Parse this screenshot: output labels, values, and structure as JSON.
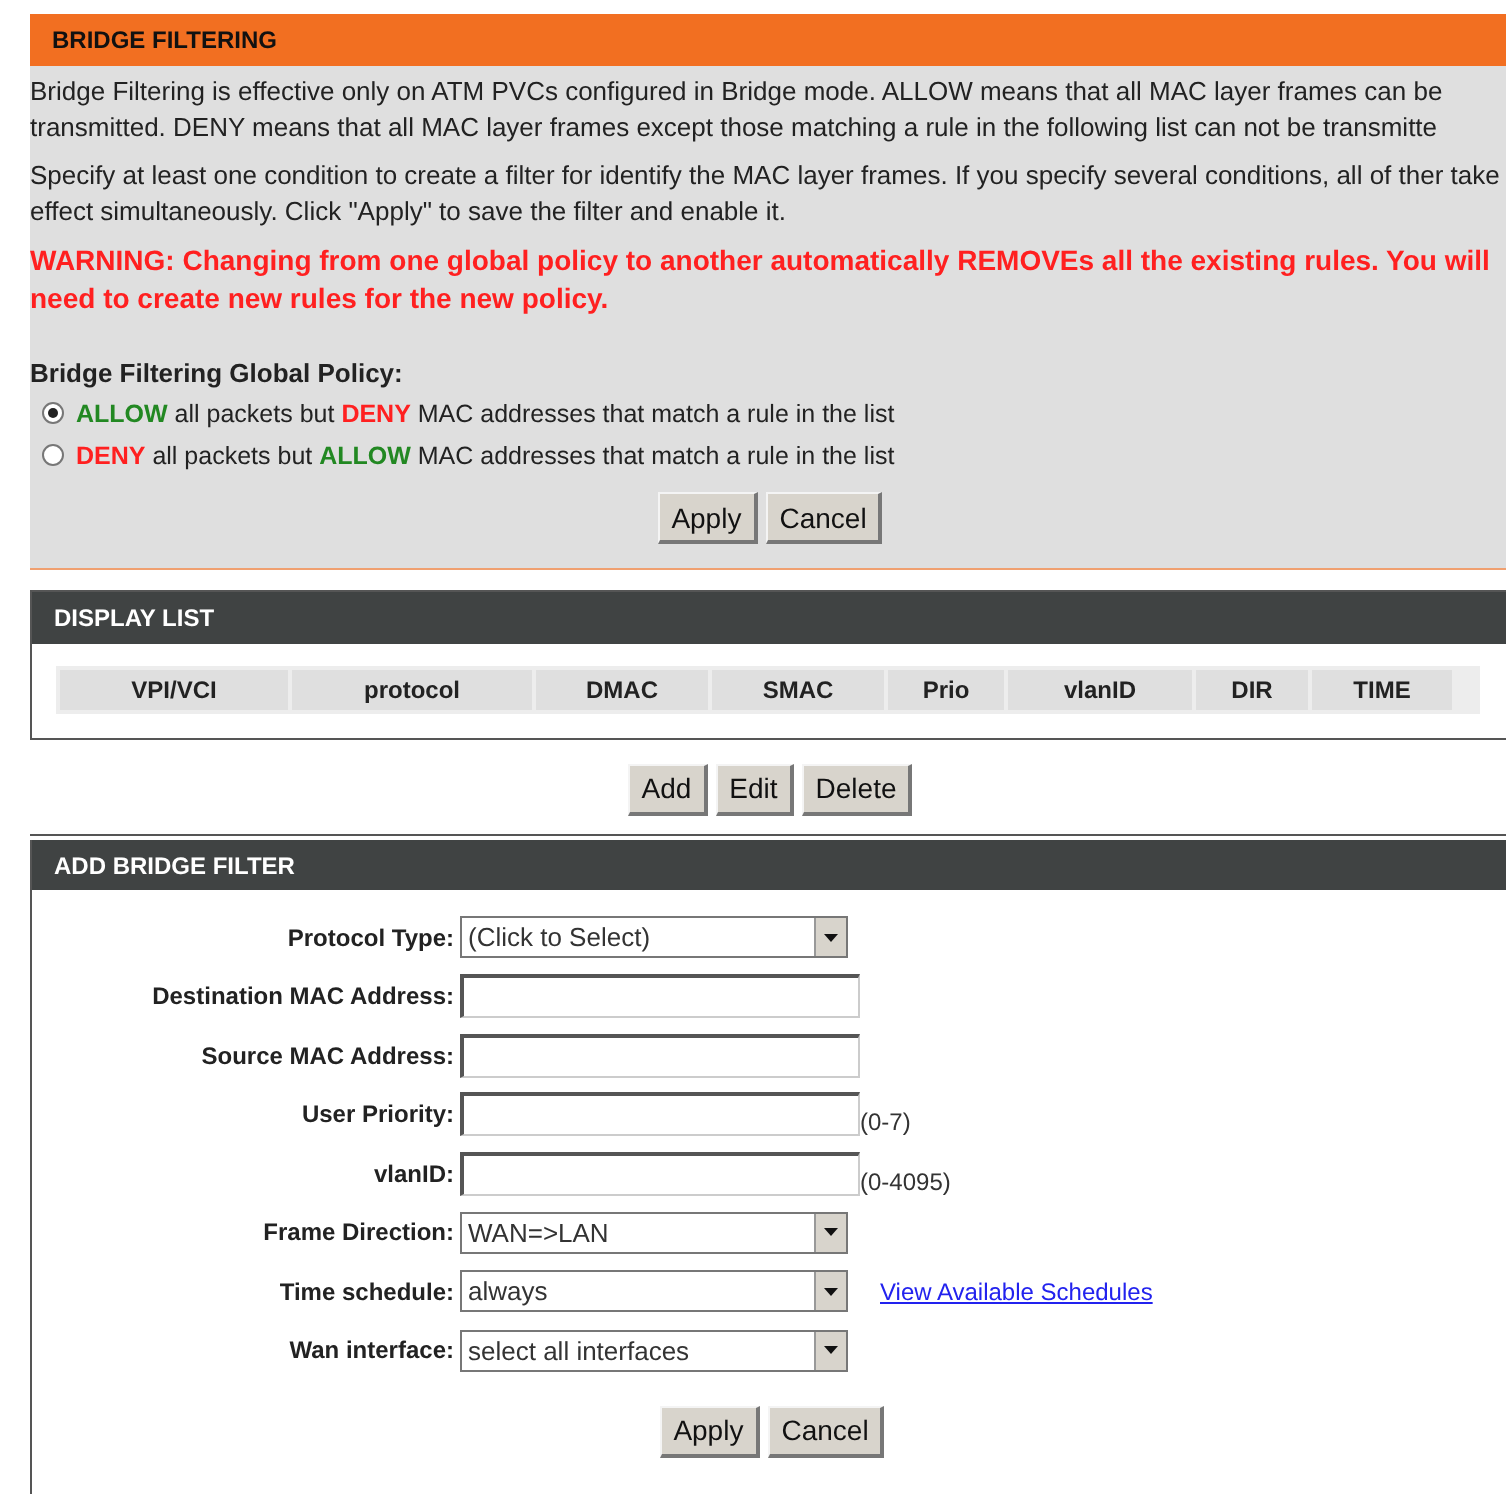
{
  "bridge_filtering": {
    "title": "BRIDGE FILTERING",
    "paragraphs": [
      "Bridge Filtering is effective only on ATM PVCs configured in Bridge mode. ALLOW means that all MAC layer frames can be transmitted. DENY means that all MAC layer frames except those matching a rule in the following list can not be transmitte",
      "Specify at least one condition to create a filter for identify the MAC layer frames. If you specify several conditions, all of ther take effect simultaneously. Click \"Apply\" to save the filter and enable it."
    ],
    "warning": "WARNING: Changing from one global policy to another automatically REMOVEs all the existing rules. You will need to create new rules for the new policy.",
    "policy_label": "Bridge Filtering Global Policy:",
    "policies": [
      {
        "selected": true,
        "parts": [
          {
            "kind": "allow",
            "text": "ALLOW"
          },
          {
            "kind": "plain",
            "text": " all packets but "
          },
          {
            "kind": "deny",
            "text": "DENY"
          },
          {
            "kind": "plain",
            "text": " MAC addresses that match a rule in the list"
          }
        ]
      },
      {
        "selected": false,
        "parts": [
          {
            "kind": "deny",
            "text": "DENY"
          },
          {
            "kind": "plain",
            "text": " all packets but "
          },
          {
            "kind": "allow",
            "text": "ALLOW"
          },
          {
            "kind": "plain",
            "text": " MAC addresses that match a rule in the list"
          }
        ]
      }
    ],
    "buttons": [
      "Apply",
      "Cancel"
    ]
  },
  "display_list": {
    "title": "DISPLAY LIST",
    "columns": [
      "VPI/VCI",
      "protocol",
      "DMAC",
      "SMAC",
      "Prio",
      "vlanID",
      "DIR",
      "TIME"
    ],
    "buttons": [
      "Add",
      "Edit",
      "Delete"
    ]
  },
  "add_bridge_filter": {
    "title": "ADD BRIDGE FILTER",
    "fields": [
      {
        "kind": "select",
        "label": "Protocol Type:",
        "value": "(Click to Select)"
      },
      {
        "kind": "input",
        "label": "Destination MAC Address:"
      },
      {
        "kind": "input",
        "label": "Source MAC Address:"
      },
      {
        "kind": "input",
        "label": "User Priority:",
        "hint": "(0-7)"
      },
      {
        "kind": "input",
        "label": "vlanID:",
        "hint": "(0-4095)"
      },
      {
        "kind": "select",
        "label": "Frame Direction:",
        "value": "WAN=>LAN"
      },
      {
        "kind": "select",
        "label": "Time schedule:",
        "value": "always",
        "link": "View Available Schedules"
      },
      {
        "kind": "select",
        "label": "Wan interface:",
        "value": "select all interfaces"
      }
    ],
    "buttons": [
      "Apply",
      "Cancel"
    ]
  }
}
